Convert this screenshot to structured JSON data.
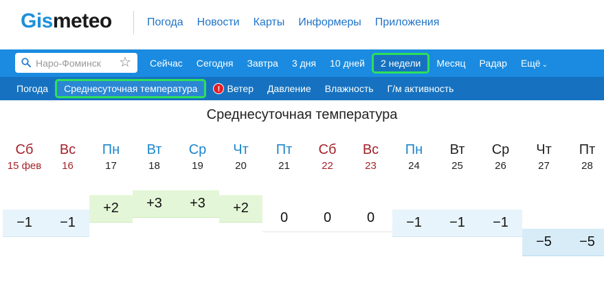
{
  "logo": {
    "part1": "Gis",
    "part2": "meteo"
  },
  "top_nav": [
    "Погода",
    "Новости",
    "Карты",
    "Информеры",
    "Приложения"
  ],
  "search": {
    "placeholder": "Наро-Фоминск"
  },
  "period_nav": [
    {
      "label": "Сейчас",
      "active": false
    },
    {
      "label": "Сегодня",
      "active": false
    },
    {
      "label": "Завтра",
      "active": false
    },
    {
      "label": "3 дня",
      "active": false
    },
    {
      "label": "10 дней",
      "active": false
    },
    {
      "label": "2 недели",
      "active": true
    },
    {
      "label": "Месяц",
      "active": false
    },
    {
      "label": "Радар",
      "active": false
    },
    {
      "label": "Ещё",
      "active": false
    }
  ],
  "parameter_nav": [
    {
      "label": "Погода",
      "active": false,
      "alert": false
    },
    {
      "label": "Среднесуточная температура",
      "active": true,
      "alert": false
    },
    {
      "label": "Ветер",
      "active": false,
      "alert": true
    },
    {
      "label": "Давление",
      "active": false,
      "alert": false
    },
    {
      "label": "Влажность",
      "active": false,
      "alert": false
    },
    {
      "label": "Г/м активность",
      "active": false,
      "alert": false
    }
  ],
  "alert_symbol": "!",
  "section_title": "Среднесуточная температура",
  "days": [
    {
      "dow": "Сб",
      "date": "15 фев",
      "weekend": true,
      "dow_color": "red",
      "date_color": "red",
      "temp": "−1",
      "value": -1
    },
    {
      "dow": "Вс",
      "date": "16",
      "weekend": true,
      "dow_color": "red",
      "date_color": "red",
      "temp": "−1",
      "value": -1
    },
    {
      "dow": "Пн",
      "date": "17",
      "weekend": false,
      "dow_color": "blue",
      "date_color": "black",
      "temp": "+2",
      "value": 2
    },
    {
      "dow": "Вт",
      "date": "18",
      "weekend": false,
      "dow_color": "blue",
      "date_color": "black",
      "temp": "+3",
      "value": 3
    },
    {
      "dow": "Ср",
      "date": "19",
      "weekend": false,
      "dow_color": "blue",
      "date_color": "black",
      "temp": "+3",
      "value": 3
    },
    {
      "dow": "Чт",
      "date": "20",
      "weekend": false,
      "dow_color": "blue",
      "date_color": "black",
      "temp": "+2",
      "value": 2
    },
    {
      "dow": "Пт",
      "date": "21",
      "weekend": false,
      "dow_color": "blue",
      "date_color": "black",
      "temp": "0",
      "value": 0
    },
    {
      "dow": "Сб",
      "date": "22",
      "weekend": true,
      "dow_color": "red",
      "date_color": "red",
      "temp": "0",
      "value": 0
    },
    {
      "dow": "Вс",
      "date": "23",
      "weekend": true,
      "dow_color": "red",
      "date_color": "red",
      "temp": "0",
      "value": 0
    },
    {
      "dow": "Пн",
      "date": "24",
      "weekend": false,
      "dow_color": "blue",
      "date_color": "black",
      "temp": "−1",
      "value": -1
    },
    {
      "dow": "Вт",
      "date": "25",
      "weekend": false,
      "dow_color": "black",
      "date_color": "black",
      "temp": "−1",
      "value": -1
    },
    {
      "dow": "Ср",
      "date": "26",
      "weekend": false,
      "dow_color": "black",
      "date_color": "black",
      "temp": "−1",
      "value": -1
    },
    {
      "dow": "Чт",
      "date": "27",
      "weekend": false,
      "dow_color": "black",
      "date_color": "black",
      "temp": "−5",
      "value": -5
    },
    {
      "dow": "Пт",
      "date": "28",
      "weekend": false,
      "dow_color": "black",
      "date_color": "black",
      "temp": "−5",
      "value": -5
    }
  ],
  "colors": {
    "brand_blue": "#1e90d8",
    "bar_blue": "#1a8be0",
    "subbar_blue": "#1672c0",
    "highlight_green": "#2ee05a",
    "weekend_red": "#a5212a",
    "weekday_blue": "#1c85cc"
  }
}
